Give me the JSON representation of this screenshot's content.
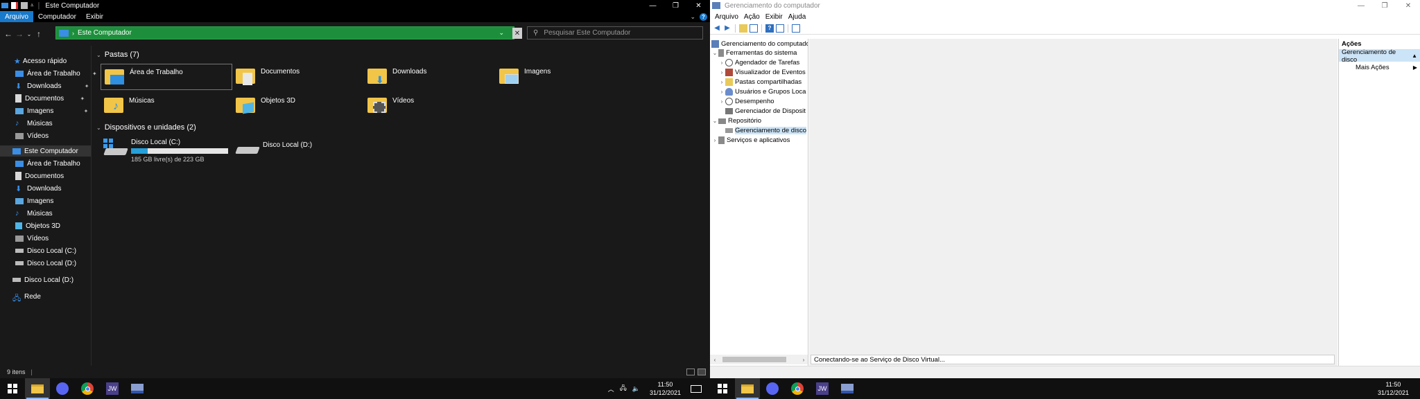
{
  "explorer": {
    "title": "Este Computador",
    "ribbon_tabs": [
      "Arquivo",
      "Computador",
      "Exibir"
    ],
    "address": "Este Computador",
    "search_placeholder": "Pesquisar Este Computador",
    "sidebar": {
      "quick_access": "Acesso rápido",
      "quick_items": [
        "Área de Trabalho",
        "Downloads",
        "Documentos",
        "Imagens",
        "Músicas",
        "Vídeos"
      ],
      "this_pc": "Este Computador",
      "pc_items": [
        "Área de Trabalho",
        "Documentos",
        "Downloads",
        "Imagens",
        "Músicas",
        "Objetos 3D",
        "Vídeos",
        "Disco Local (C:)",
        "Disco Local (D:)"
      ],
      "extra_drive": "Disco Local (D:)",
      "network": "Rede"
    },
    "folders_header": "Pastas (7)",
    "folders": [
      "Área de Trabalho",
      "Documentos",
      "Downloads",
      "Imagens",
      "Músicas",
      "Objetos 3D",
      "Vídeos"
    ],
    "devices_header": "Dispositivos e unidades (2)",
    "drives": [
      {
        "name": "Disco Local (C:)",
        "free_text": "185 GB livre(s) de 223 GB",
        "used_fraction": 0.17
      },
      {
        "name": "Disco Local (D:)"
      }
    ],
    "status": "9 itens"
  },
  "compmgmt": {
    "title": "Gerenciamento do computador",
    "menu": [
      "Arquivo",
      "Ação",
      "Exibir",
      "Ajuda"
    ],
    "tree": {
      "root": "Gerenciamento do computado",
      "system_tools": "Ferramentas do sistema",
      "tools": [
        "Agendador de Tarefas",
        "Visualizador de Eventos",
        "Pastas compartilhadas",
        "Usuários e Grupos Loca",
        "Desempenho",
        "Gerenciador de Disposit"
      ],
      "storage": "Repositório",
      "disk_mgmt": "Gerenciamento de disco",
      "services": "Serviços e aplicativos"
    },
    "status_text": "Conectando-se ao Serviço de Disco Virtual...",
    "actions": {
      "header": "Ações",
      "selected": "Gerenciamento de disco",
      "more": "Mais Ações"
    }
  },
  "taskbar": {
    "time": "11:50",
    "date": "31/12/2021"
  },
  "colors": {
    "accent": "#1979ca",
    "address_green": "#1d8f3c",
    "drive_fill": "#26a0da"
  }
}
